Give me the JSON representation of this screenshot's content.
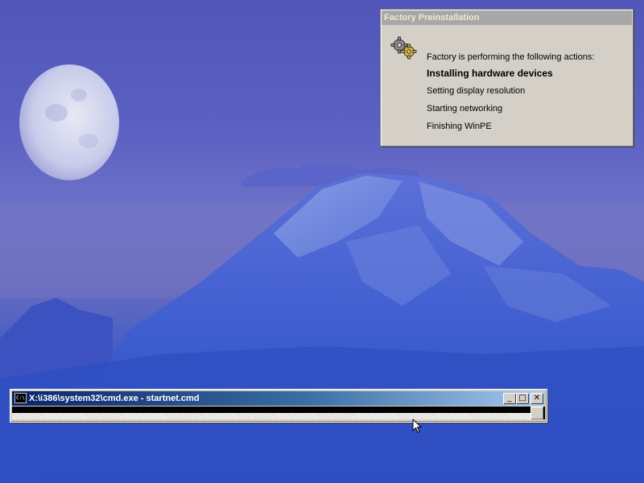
{
  "factory_dialog": {
    "title": "Factory Preinstallation",
    "lead": "Factory is performing the following actions:",
    "steps": [
      "Installing hardware devices",
      "Setting display resolution",
      "Starting networking",
      "Finishing WinPE"
    ],
    "icon": "gears-icon"
  },
  "cmd_window": {
    "title": "X:\\i386\\system32\\cmd.exe - startnet.cmd",
    "icon_text": "C:\\",
    "minimize_glyph": "_",
    "maximize_glyph": "□",
    "close_glyph": "✕"
  },
  "colors": {
    "title_active_start": "#0a246a",
    "title_active_end": "#a6caf0",
    "dialog_face": "#d4d0c8",
    "dialog_title_inactive": "#a7a7a7"
  }
}
